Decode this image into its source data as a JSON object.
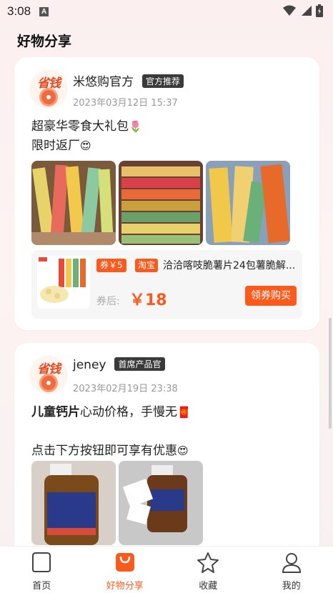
{
  "status_bar": {
    "time": "3:08",
    "indicator": "A"
  },
  "header": {
    "title": "好物分享"
  },
  "posts": [
    {
      "user": "米悠购官方",
      "badge": "官方推荐",
      "date": "2023年03月12日 15:37",
      "line1": "超豪华零食大礼包",
      "line1_emoji": "🌷",
      "line2": "限时返厂",
      "line2_emoji": "😍",
      "product": {
        "coupon": "券￥5",
        "platform": "淘宝",
        "title": "洽洽喀吱脆薯片24包薯脆解...",
        "after_label": "券后:",
        "price": "￥18",
        "button": "领券购买"
      }
    },
    {
      "user": "jeney",
      "badge": "首席产品官",
      "date": "2023年02月19日 23:38",
      "line1_bold": "儿童钙片",
      "line1_rest": "心动价格，手慢无",
      "line1_emoji": "🧧",
      "line2": "点击下方按钮即可享有优惠",
      "line2_emoji": "😍"
    }
  ],
  "avatar_text": "省钱",
  "tabs": [
    {
      "label": "首页",
      "icon": "home-icon"
    },
    {
      "label": "好物分享",
      "icon": "shopping-bag-icon"
    },
    {
      "label": "收藏",
      "icon": "star-icon"
    },
    {
      "label": "我的",
      "icon": "user-icon"
    }
  ],
  "colors": {
    "accent": "#fb5a1d",
    "tag_bg": "#3a3a3a"
  }
}
